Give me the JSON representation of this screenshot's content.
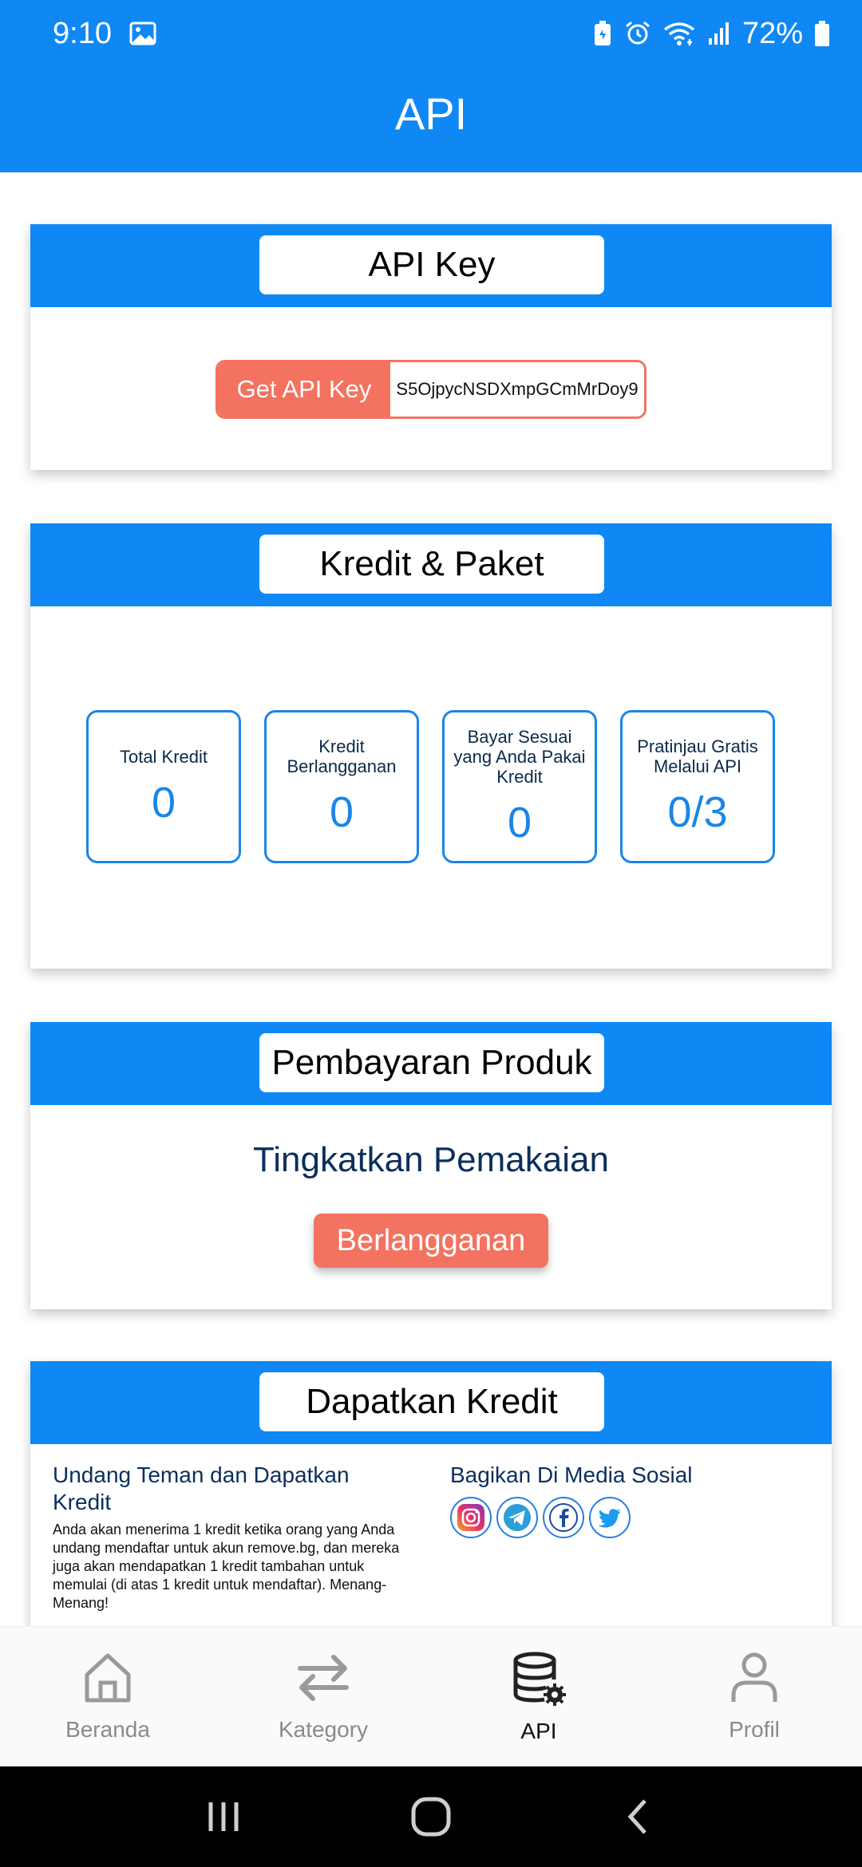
{
  "status_bar": {
    "time": "9:10",
    "battery": "72%",
    "icons": [
      "gallery-icon",
      "battery-saver-icon",
      "alarm-icon",
      "wifi-icon",
      "signal-icon",
      "battery-icon"
    ]
  },
  "header": {
    "title": "API"
  },
  "api_key_card": {
    "title": "API Key",
    "button_label": "Get API Key",
    "key_value": "S5OjpycNSDXmpGCmMrDoy9"
  },
  "kredit_card": {
    "title": "Kredit & Paket",
    "stats": [
      {
        "label": "Total Kredit",
        "value": "0"
      },
      {
        "label": "Kredit Berlangganan",
        "value": "0"
      },
      {
        "label": "Bayar Sesuai yang Anda Pakai Kredit",
        "value": "0"
      },
      {
        "label": "Pratinjau Gratis Melalui API",
        "value": "0/3"
      }
    ]
  },
  "payment_card": {
    "title": "Pembayaran Produk",
    "headline": "Tingkatkan Pemakaian",
    "button_label": "Berlangganan"
  },
  "credit_card": {
    "title": "Dapatkan Kredit",
    "invite_title": "Undang Teman dan Dapatkan Kredit",
    "invite_desc": "Anda akan menerima 1 kredit ketika orang yang Anda undang mendaftar untuk akun remove.bg, dan mereka juga akan mendapatkan 1 kredit tambahan untuk memulai (di atas 1 kredit untuk mendaftar). Menang-Menang!",
    "share_title": "Bagikan Di Media Sosial",
    "socials": [
      "instagram-icon",
      "telegram-icon",
      "facebook-icon",
      "twitter-icon"
    ]
  },
  "bottom_nav": {
    "items": [
      {
        "label": "Beranda",
        "icon": "home-icon",
        "active": false
      },
      {
        "label": "Kategory",
        "icon": "swap-arrows-icon",
        "active": false
      },
      {
        "label": "API",
        "icon": "database-gear-icon",
        "active": true
      },
      {
        "label": "Profil",
        "icon": "person-icon",
        "active": false
      }
    ]
  },
  "colors": {
    "primary": "#0f88f5",
    "accent": "#f47260",
    "stat_blue": "#1a86e6",
    "dark_text": "#0b2f5c"
  }
}
